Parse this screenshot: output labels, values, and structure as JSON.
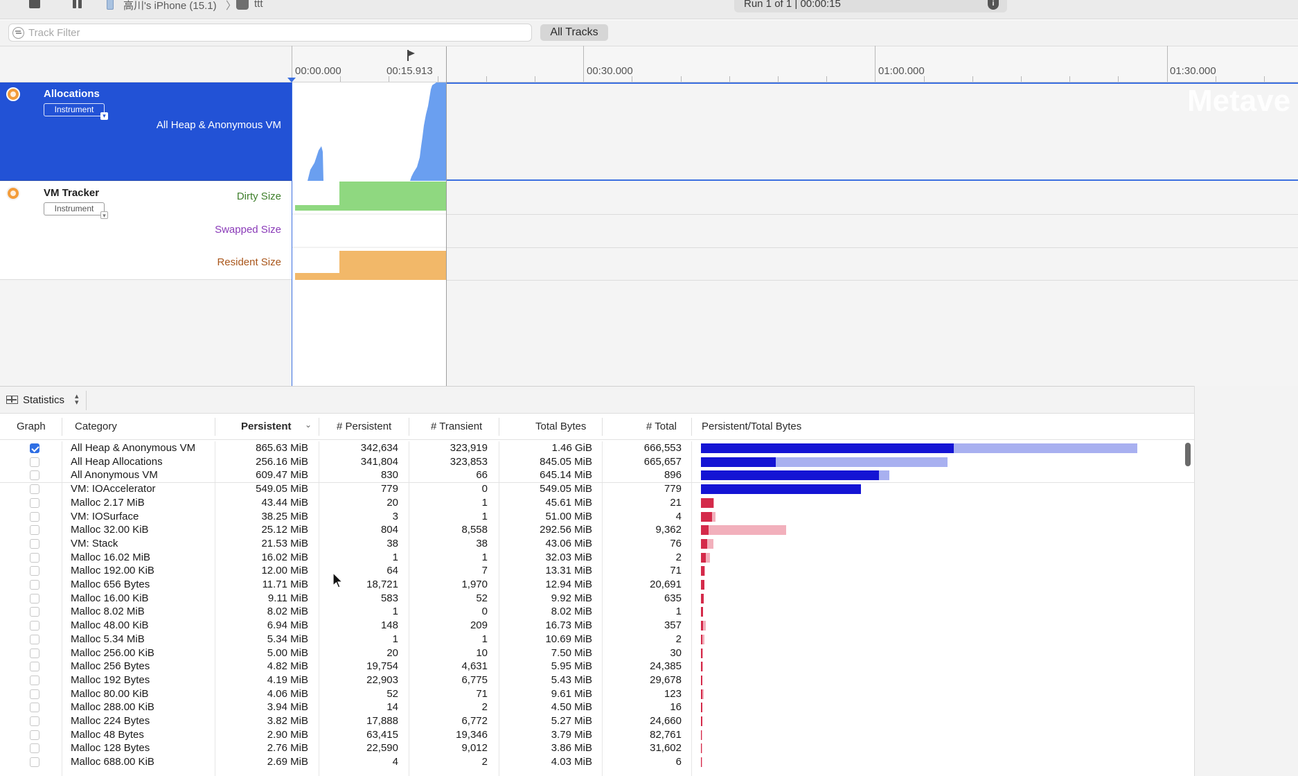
{
  "toolbar": {
    "device": "高川's iPhone (15.1)",
    "separator": "〉",
    "app": "ttt",
    "run": "Run 1 of 1  |  00:00:15",
    "info_icon": "info-icon",
    "stop_icon": "stop-icon",
    "pause_icon": "pause-icon"
  },
  "filter": {
    "placeholder": "Track Filter",
    "all_tracks": "All Tracks"
  },
  "ruler": {
    "labels": [
      "00:00.000",
      "00:15.913",
      "00:30.000",
      "01:00.000",
      "01:30.000"
    ]
  },
  "watermark": "Metave",
  "tracks": {
    "allocations": {
      "title": "Allocations",
      "instrument": "Instrument",
      "subtitle": "All Heap & Anonymous VM",
      "color": "#6a9ff0"
    },
    "vm_tracker": {
      "title": "VM Tracker",
      "instrument": "Instrument",
      "dirty": "Dirty Size",
      "swapped": "Swapped Size",
      "resident": "Resident Size",
      "dirty_color": "#8fd880",
      "resident_color": "#f2b869"
    }
  },
  "statistics": {
    "label": "Statistics",
    "columns": {
      "graph": "Graph",
      "category": "Category",
      "persistent": "Persistent",
      "num_persistent": "# Persistent",
      "num_transient": "# Transient",
      "total_bytes": "Total Bytes",
      "num_total": "# Total",
      "ratio": "Persistent/Total Bytes"
    },
    "rows": [
      {
        "checked": true,
        "category": "All Heap & Anonymous VM",
        "persistent": "865.63 MiB",
        "num_persistent": "342,634",
        "num_transient": "323,919",
        "total_bytes": "1.46 GiB",
        "num_total": "666,553",
        "p_mb": 865.63,
        "t_mb": 1495.0
      },
      {
        "checked": false,
        "category": "All Heap Allocations",
        "persistent": "256.16 MiB",
        "num_persistent": "341,804",
        "num_transient": "323,853",
        "total_bytes": "845.05 MiB",
        "num_total": "665,657",
        "p_mb": 256.16,
        "t_mb": 845.05
      },
      {
        "checked": false,
        "category": "All Anonymous VM",
        "persistent": "609.47 MiB",
        "num_persistent": "830",
        "num_transient": "66",
        "total_bytes": "645.14 MiB",
        "num_total": "896",
        "p_mb": 609.47,
        "t_mb": 645.14
      },
      {
        "checked": false,
        "category": "VM: IOAccelerator",
        "persistent": "549.05 MiB",
        "num_persistent": "779",
        "num_transient": "0",
        "total_bytes": "549.05 MiB",
        "num_total": "779",
        "p_mb": 549.05,
        "t_mb": 549.05
      },
      {
        "checked": false,
        "category": "Malloc 2.17 MiB",
        "persistent": "43.44 MiB",
        "num_persistent": "20",
        "num_transient": "1",
        "total_bytes": "45.61 MiB",
        "num_total": "21",
        "p_mb": 43.44,
        "t_mb": 45.61
      },
      {
        "checked": false,
        "category": "VM: IOSurface",
        "persistent": "38.25 MiB",
        "num_persistent": "3",
        "num_transient": "1",
        "total_bytes": "51.00 MiB",
        "num_total": "4",
        "p_mb": 38.25,
        "t_mb": 51.0
      },
      {
        "checked": false,
        "category": "Malloc 32.00 KiB",
        "persistent": "25.12 MiB",
        "num_persistent": "804",
        "num_transient": "8,558",
        "total_bytes": "292.56 MiB",
        "num_total": "9,362",
        "p_mb": 25.12,
        "t_mb": 292.56
      },
      {
        "checked": false,
        "category": "VM: Stack",
        "persistent": "21.53 MiB",
        "num_persistent": "38",
        "num_transient": "38",
        "total_bytes": "43.06 MiB",
        "num_total": "76",
        "p_mb": 21.53,
        "t_mb": 43.06
      },
      {
        "checked": false,
        "category": "Malloc 16.02 MiB",
        "persistent": "16.02 MiB",
        "num_persistent": "1",
        "num_transient": "1",
        "total_bytes": "32.03 MiB",
        "num_total": "2",
        "p_mb": 16.02,
        "t_mb": 32.03
      },
      {
        "checked": false,
        "category": "Malloc 192.00 KiB",
        "persistent": "12.00 MiB",
        "num_persistent": "64",
        "num_transient": "7",
        "total_bytes": "13.31 MiB",
        "num_total": "71",
        "p_mb": 12.0,
        "t_mb": 13.31
      },
      {
        "checked": false,
        "category": "Malloc 656 Bytes",
        "persistent": "11.71 MiB",
        "num_persistent": "18,721",
        "num_transient": "1,970",
        "total_bytes": "12.94 MiB",
        "num_total": "20,691",
        "p_mb": 11.71,
        "t_mb": 12.94
      },
      {
        "checked": false,
        "category": "Malloc 16.00 KiB",
        "persistent": "9.11 MiB",
        "num_persistent": "583",
        "num_transient": "52",
        "total_bytes": "9.92 MiB",
        "num_total": "635",
        "p_mb": 9.11,
        "t_mb": 9.92
      },
      {
        "checked": false,
        "category": "Malloc 8.02 MiB",
        "persistent": "8.02 MiB",
        "num_persistent": "1",
        "num_transient": "0",
        "total_bytes": "8.02 MiB",
        "num_total": "1",
        "p_mb": 8.02,
        "t_mb": 8.02
      },
      {
        "checked": false,
        "category": "Malloc 48.00 KiB",
        "persistent": "6.94 MiB",
        "num_persistent": "148",
        "num_transient": "209",
        "total_bytes": "16.73 MiB",
        "num_total": "357",
        "p_mb": 6.94,
        "t_mb": 16.73
      },
      {
        "checked": false,
        "category": "Malloc 5.34 MiB",
        "persistent": "5.34 MiB",
        "num_persistent": "1",
        "num_transient": "1",
        "total_bytes": "10.69 MiB",
        "num_total": "2",
        "p_mb": 5.34,
        "t_mb": 10.69
      },
      {
        "checked": false,
        "category": "Malloc 256.00 KiB",
        "persistent": "5.00 MiB",
        "num_persistent": "20",
        "num_transient": "10",
        "total_bytes": "7.50 MiB",
        "num_total": "30",
        "p_mb": 5.0,
        "t_mb": 7.5
      },
      {
        "checked": false,
        "category": "Malloc 256 Bytes",
        "persistent": "4.82 MiB",
        "num_persistent": "19,754",
        "num_transient": "4,631",
        "total_bytes": "5.95 MiB",
        "num_total": "24,385",
        "p_mb": 4.82,
        "t_mb": 5.95
      },
      {
        "checked": false,
        "category": "Malloc 192 Bytes",
        "persistent": "4.19 MiB",
        "num_persistent": "22,903",
        "num_transient": "6,775",
        "total_bytes": "5.43 MiB",
        "num_total": "29,678",
        "p_mb": 4.19,
        "t_mb": 5.43
      },
      {
        "checked": false,
        "category": "Malloc 80.00 KiB",
        "persistent": "4.06 MiB",
        "num_persistent": "52",
        "num_transient": "71",
        "total_bytes": "9.61 MiB",
        "num_total": "123",
        "p_mb": 4.06,
        "t_mb": 9.61
      },
      {
        "checked": false,
        "category": "Malloc 288.00 KiB",
        "persistent": "3.94 MiB",
        "num_persistent": "14",
        "num_transient": "2",
        "total_bytes": "4.50 MiB",
        "num_total": "16",
        "p_mb": 3.94,
        "t_mb": 4.5
      },
      {
        "checked": false,
        "category": "Malloc 224 Bytes",
        "persistent": "3.82 MiB",
        "num_persistent": "17,888",
        "num_transient": "6,772",
        "total_bytes": "5.27 MiB",
        "num_total": "24,660",
        "p_mb": 3.82,
        "t_mb": 5.27
      },
      {
        "checked": false,
        "category": "Malloc 48 Bytes",
        "persistent": "2.90 MiB",
        "num_persistent": "63,415",
        "num_transient": "19,346",
        "total_bytes": "3.79 MiB",
        "num_total": "82,761",
        "p_mb": 2.9,
        "t_mb": 3.79
      },
      {
        "checked": false,
        "category": "Malloc 128 Bytes",
        "persistent": "2.76 MiB",
        "num_persistent": "22,590",
        "num_transient": "9,012",
        "total_bytes": "3.86 MiB",
        "num_total": "31,602",
        "p_mb": 2.76,
        "t_mb": 3.86
      },
      {
        "checked": false,
        "category": "Malloc 688.00 KiB",
        "persistent": "2.69 MiB",
        "num_persistent": "4",
        "num_transient": "2",
        "total_bytes": "4.03 MiB",
        "num_total": "6",
        "p_mb": 2.69,
        "t_mb": 4.03
      }
    ],
    "colors": {
      "aggregate_persistent": "#1414d4",
      "aggregate_total": "#a8b0f0",
      "detail_persistent": "#d42a4a",
      "detail_total": "#f2b0bc"
    }
  }
}
